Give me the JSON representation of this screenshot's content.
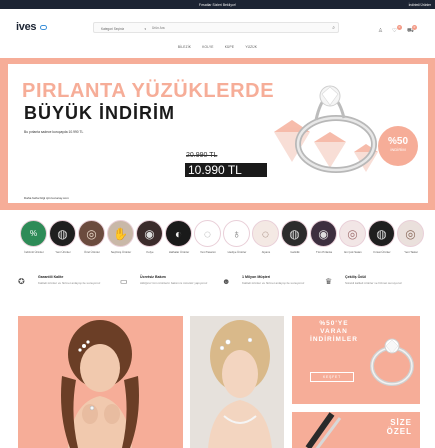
{
  "topbar": {
    "promo": "Fırsatlar Sizleri Bekliyor!",
    "contact": "İndirimli Ürünler"
  },
  "header": {
    "logo": "ives",
    "search_category": "Kategori Seçiniz",
    "search_placeholder": "Ürün Ara",
    "cart_count": "0",
    "fav_count": "0"
  },
  "nav": {
    "items": [
      "BİLEZİK",
      "KOLYE",
      "KÜPE",
      "YÜZÜK"
    ]
  },
  "hero": {
    "title_line1": "PIRLANTA YÜZÜKLERDE",
    "title_line2": "BÜYÜK İNDİRİM",
    "subtitle": "Bu pırlanta sadece kuruçayda 10.990 TL",
    "old_price": "20.990 TL",
    "new_price": "10.990 TL",
    "note": "Daha fazla bilgi için kurucay.com",
    "badge_percent": "%50",
    "badge_text": "İNDİRİM"
  },
  "categories": [
    {
      "label": "İndirimli Ürünler",
      "icon": "%"
    },
    {
      "label": "Yeni Ürünler",
      "icon": "ring"
    },
    {
      "label": "Özel Ürünler",
      "icon": "ring"
    },
    {
      "label": "Seçilmiş Ürünler",
      "icon": "ring"
    },
    {
      "label": "Kolye",
      "icon": "necklace"
    },
    {
      "label": "Halhalar Ürünler",
      "icon": "ring"
    },
    {
      "label": "Yeni Tasarım",
      "icon": "outline"
    },
    {
      "label": "Hediye Ürünler",
      "icon": "outline"
    },
    {
      "label": "Alyans",
      "icon": "ring"
    },
    {
      "label": "Gelinlik",
      "icon": "ring"
    },
    {
      "label": "Tüm Pırlanta",
      "icon": "ring"
    },
    {
      "label": "En Çok Satan",
      "icon": "ring"
    },
    {
      "label": "Fırsat Ürünler",
      "icon": "ring"
    },
    {
      "label": "Yeni Taslar",
      "icon": "ring"
    }
  ],
  "features": [
    {
      "title": "Garantili Kalite",
      "desc": "Kaliteli ürünler ve hizmet anlayışı ile sunuyoruz",
      "icon": "badge-icon"
    },
    {
      "title": "Ücretsiz Bakım",
      "desc": "Aldığınız tüm ürünlerin bakımını ücretsiz yapıyoruz",
      "icon": "card-icon"
    },
    {
      "title": "1 Milyon Müşteri",
      "desc": "Kaliteli ürünler ve hizmet anlayışı ile sunuyoruz",
      "icon": "users-icon"
    },
    {
      "title": "Çekiliş Ödül",
      "desc": "Sürekli kaliteli ürünler ve hizmet sunuyoruz",
      "icon": "trophy-icon"
    }
  ],
  "banners": {
    "b3_lines": [
      "%50'YE",
      "VARAN",
      "İNDİRİMLER"
    ],
    "b3_button": "KEŞFET",
    "b4_lines": [
      "SİZE",
      "ÖZEL"
    ]
  },
  "colors": {
    "accent": "#f6ad98",
    "dark": "#1a1a1a",
    "topbar": "#1c2433"
  }
}
